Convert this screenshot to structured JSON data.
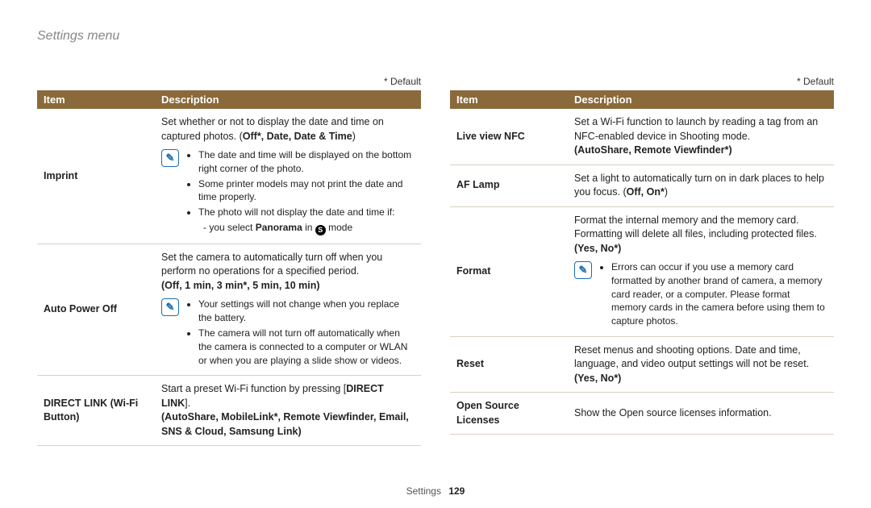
{
  "page_title": "Settings menu",
  "default_label": "* Default",
  "header": {
    "item": "Item",
    "description": "Description"
  },
  "footer": {
    "label": "Settings",
    "page": "129"
  },
  "note_glyph": "✎",
  "mode_glyph": "S",
  "left": {
    "imprint": {
      "name": "Imprint",
      "lead": "Set whether or not to display the date and time on captured photos. (",
      "opts": "Off*, Date, Date & Time",
      "tail": ")",
      "notes": [
        "The date and time will be displayed on the bottom right corner of the photo.",
        "Some printer models may not print the date and time properly.",
        "The photo will not display the date and time if:"
      ],
      "sub_pre": "you select ",
      "sub_bold": "Panorama",
      "sub_mid": " in ",
      "sub_post": " mode"
    },
    "auto_off": {
      "name": "Auto Power Off",
      "lead": "Set the camera to automatically turn off when you perform no operations for a specified period.",
      "opts": "(Off, 1 min, 3 min*, 5 min, 10 min)",
      "notes": [
        "Your settings will not change when you replace the battery.",
        "The camera will not turn off automatically when the camera is connected to a computer or WLAN or when you are playing a slide show or videos."
      ]
    },
    "direct_link": {
      "name": "DIRECT LINK (Wi-Fi Button)",
      "lead_pre": "Start a preset Wi-Fi function by pressing [",
      "lead_bold": "DIRECT LINK",
      "lead_post": "].",
      "opts": "(AutoShare, MobileLink*, Remote Viewfinder, Email, SNS & Cloud, Samsung Link)"
    }
  },
  "right": {
    "nfc": {
      "name": "Live view NFC",
      "lead": "Set a Wi-Fi function to launch by reading a tag from an NFC-enabled device in Shooting mode.",
      "opts": "(AutoShare, Remote Viewfinder*)"
    },
    "af_lamp": {
      "name": "AF Lamp",
      "lead": "Set a light to automatically turn on in dark places to help you focus. (",
      "opts": "Off, On*",
      "tail": ")"
    },
    "format": {
      "name": "Format",
      "lead": "Format the internal memory and the memory card. Formatting will delete all files, including protected files.",
      "opts": "(Yes, No*)",
      "note": "Errors can occur if you use a memory card formatted by another brand of camera, a memory card reader, or a computer. Please format memory cards in the camera before using them to capture photos."
    },
    "reset": {
      "name": "Reset",
      "lead": "Reset menus and shooting options. Date and time, language, and video output settings will not be reset.",
      "opts": "(Yes, No*)"
    },
    "osl": {
      "name": "Open Source Licenses",
      "lead": "Show the Open source licenses information."
    }
  }
}
